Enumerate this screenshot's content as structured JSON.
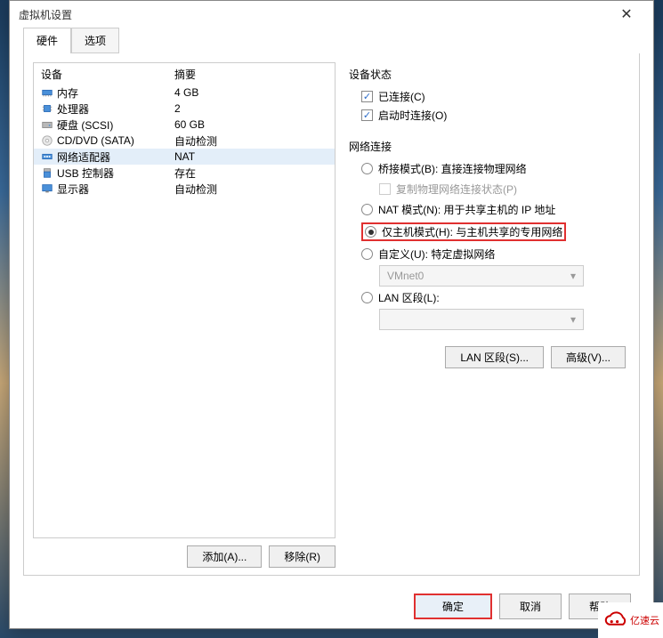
{
  "window": {
    "title": "虚拟机设置"
  },
  "tabs": {
    "hardware": "硬件",
    "options": "选项"
  },
  "hw_table": {
    "col1": "设备",
    "col2": "摘要",
    "rows": [
      {
        "name": "内存",
        "summary": "4 GB"
      },
      {
        "name": "处理器",
        "summary": "2"
      },
      {
        "name": "硬盘 (SCSI)",
        "summary": "60 GB"
      },
      {
        "name": "CD/DVD (SATA)",
        "summary": "自动检测"
      },
      {
        "name": "网络适配器",
        "summary": "NAT"
      },
      {
        "name": "USB 控制器",
        "summary": "存在"
      },
      {
        "name": "显示器",
        "summary": "自动检测"
      }
    ]
  },
  "buttons": {
    "add": "添加(A)...",
    "remove": "移除(R)"
  },
  "device_status": {
    "title": "设备状态",
    "connected": "已连接(C)",
    "connect_on": "启动时连接(O)"
  },
  "net": {
    "title": "网络连接",
    "bridge": "桥接模式(B): 直接连接物理网络",
    "replicate": "复制物理网络连接状态(P)",
    "nat": "NAT 模式(N): 用于共享主机的 IP 地址",
    "hostonly": "仅主机模式(H): 与主机共享的专用网络",
    "custom": "自定义(U): 特定虚拟网络",
    "vmnet": "VMnet0",
    "lanseg": "LAN 区段(L):",
    "lanseg_btn": "LAN 区段(S)...",
    "advanced_btn": "高级(V)..."
  },
  "bottom": {
    "ok": "确定",
    "cancel": "取消",
    "help": "帮助"
  },
  "watermark": "亿速云"
}
